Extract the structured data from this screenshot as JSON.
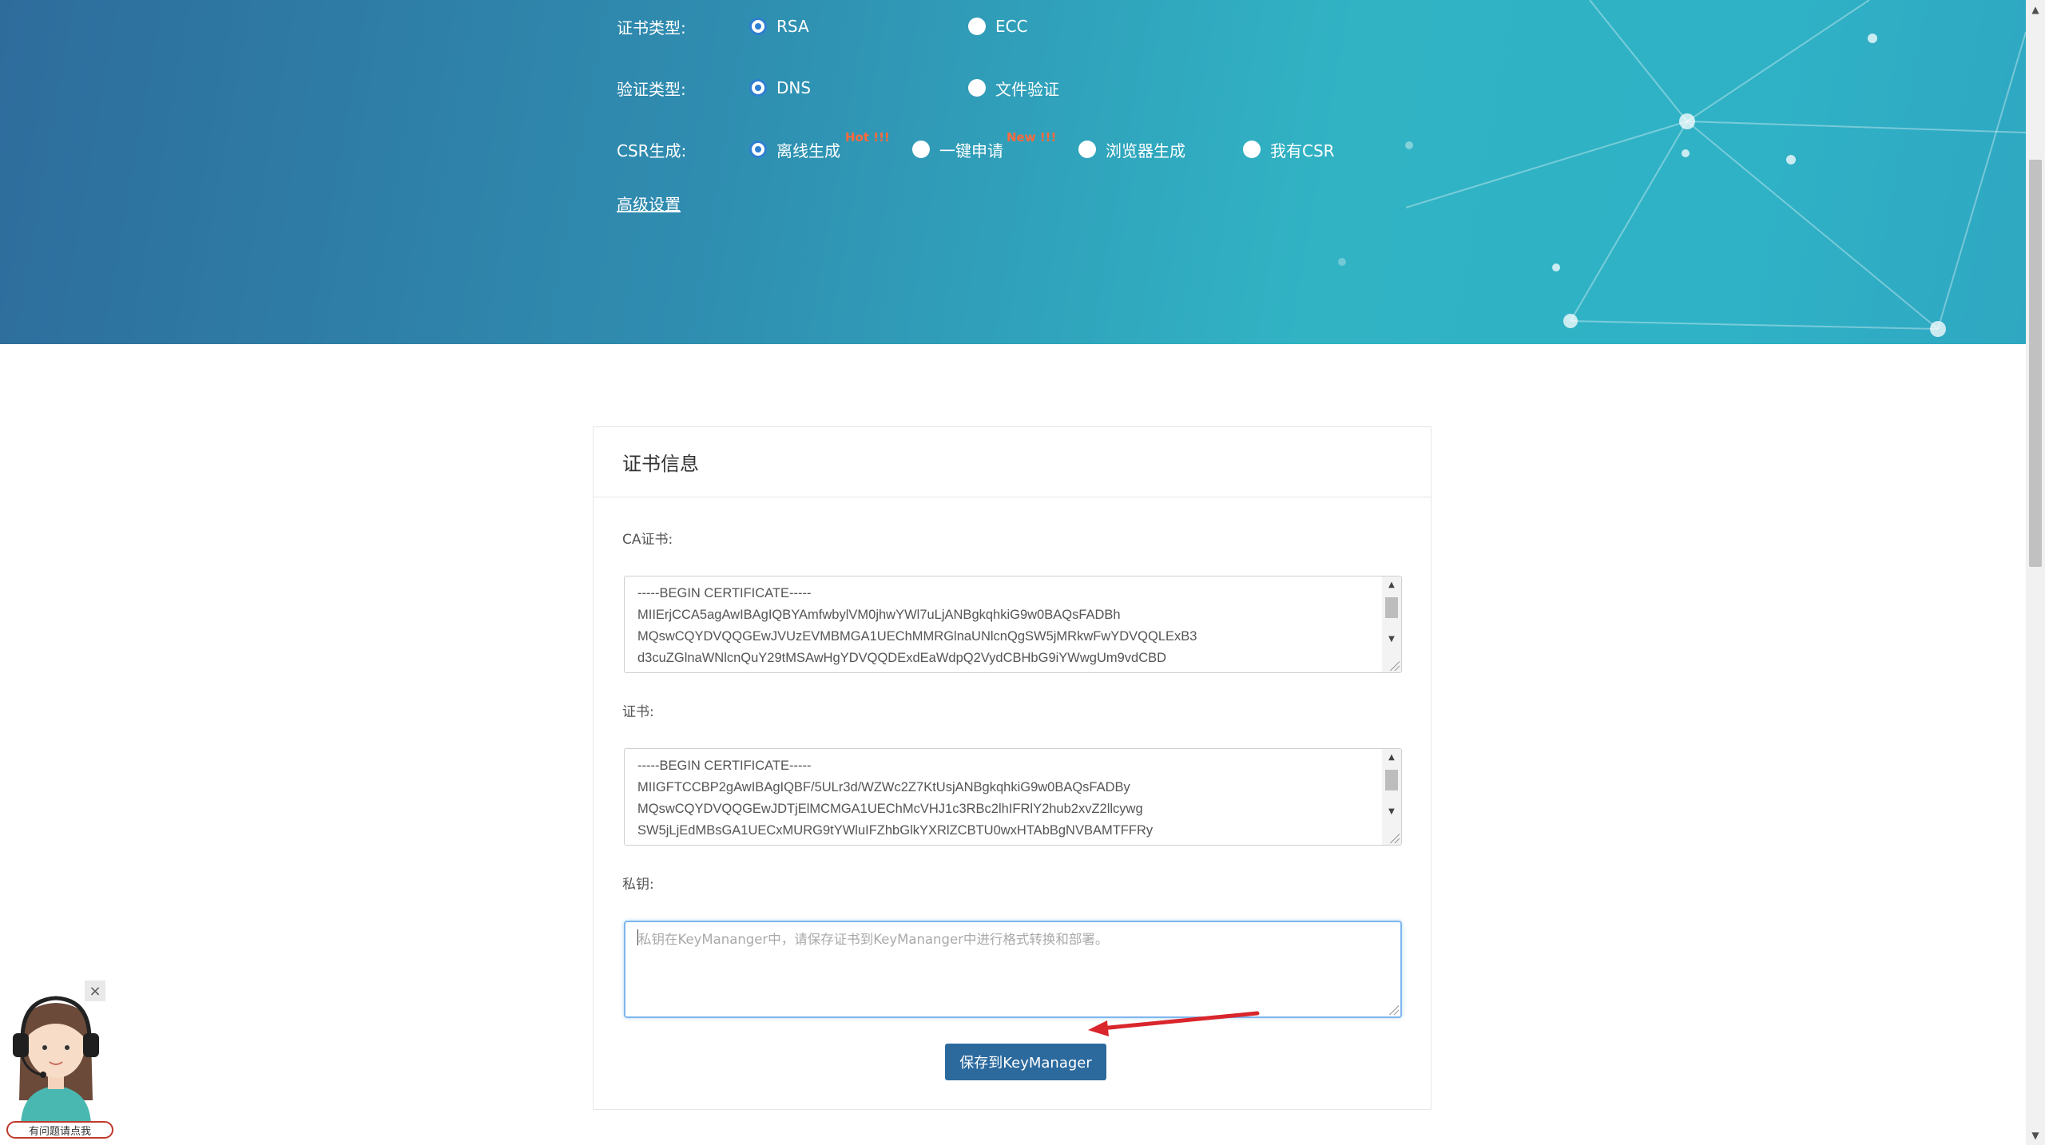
{
  "hero": {
    "cert_type": {
      "label": "证书类型:",
      "options": [
        "RSA",
        "ECC"
      ],
      "selected": "RSA"
    },
    "verify_type": {
      "label": "验证类型:",
      "options": [
        "DNS",
        "文件验证"
      ],
      "selected": "DNS"
    },
    "csr": {
      "label": "CSR生成:",
      "options": [
        "离线生成",
        "一键申请",
        "浏览器生成",
        "我有CSR"
      ],
      "badges": [
        "Hot !!!",
        "New !!!"
      ],
      "selected": "离线生成"
    },
    "advanced_link": "高级设置"
  },
  "card": {
    "title": "证书信息",
    "ca_label": "CA证书:",
    "ca_text": "-----BEGIN CERTIFICATE-----\nMIIErjCCA5agAwIBAgIQBYAmfwbylVM0jhwYWl7uLjANBgkqhkiG9w0BAQsFADBh\nMQswCQYDVQQGEwJVUzEVMBMGA1UEChMMRGlnaUNlcnQgSW5jMRkwFwYDVQQLExB3\nd3cuZGlnaWNlcnQuY29tMSAwHgYDVQQDExdEaWdpQ2VydCBHbG9iYWwgUm9vdCBD",
    "cert_label": "证书:",
    "cert_text": "-----BEGIN CERTIFICATE-----\nMIIGFTCCBP2gAwIBAgIQBF/5ULr3d/WZWc2Z7KtUsjANBgkqhkiG9w0BAQsFADBy\nMQswCQYDVQQGEwJDTjElMCMGA1UEChMcVHJ1c3RBc2lhIFRlY2hub2xvZ2llcywg\nSW5jLjEdMBsGA1UECxMURG9tYWluIFZhbGlkYXRlZCBTU0wxHTAbBgNVBAMTFFRy",
    "key_label": "私钥:",
    "key_placeholder": "私钥在KeyMananger中，请保存证书到KeyMananger中进行格式转换和部署。",
    "save_button": "保存到KeyManager"
  },
  "support": {
    "help_label": "有问题请点我",
    "close_icon": "×"
  },
  "colors": {
    "radio_accent": "#2e7fd1",
    "badge": "#ff6a3d",
    "button": "#2c6a9e",
    "arrow": "#d9262c"
  }
}
